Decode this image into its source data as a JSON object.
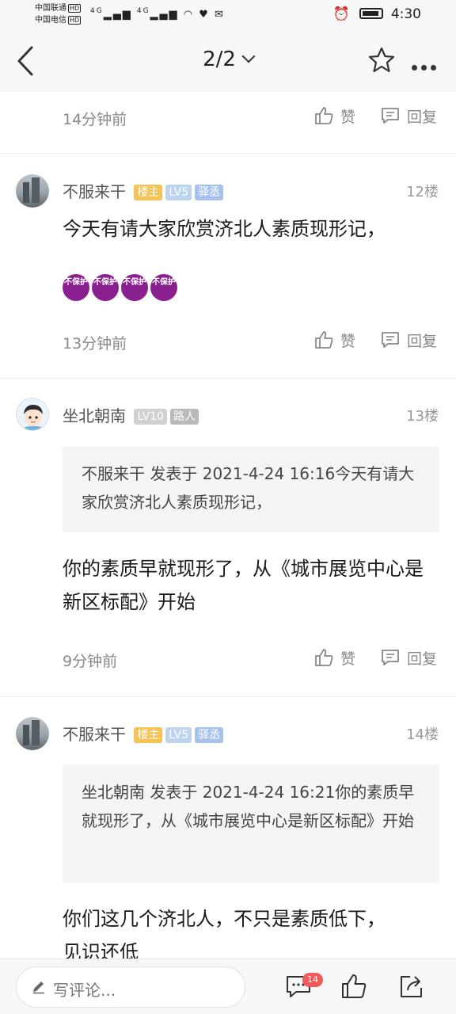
{
  "status_bar": {
    "carrier_1": "中国联通",
    "carrier_2": "中国电信",
    "hd_label": "HD",
    "network": "4G",
    "time": "4:30"
  },
  "nav": {
    "page_indicator": "2/2"
  },
  "top_meta": {
    "time": "14分钟前",
    "like_label": "赞",
    "reply_label": "回复"
  },
  "posts": [
    {
      "username": "不服来干",
      "badges": [
        "楼主",
        "LV5",
        "驿丞"
      ],
      "floor": "12楼",
      "text": "今天有请大家欣赏济北人素质现形记，",
      "emojis": [
        "不保护",
        "不保护",
        "不保护",
        "不保护"
      ],
      "time": "13分钟前",
      "like_label": "赞",
      "reply_label": "回复"
    },
    {
      "username": "坐北朝南",
      "badges": [
        "LV10",
        "路人"
      ],
      "floor": "13楼",
      "quote": "不服来干 发表于 2021-4-24 16:16今天有请大家欣赏济北人素质现形记，",
      "text": "你的素质早就现形了，从《城市展览中心是新区标配》开始",
      "time": "9分钟前",
      "like_label": "赞",
      "reply_label": "回复"
    },
    {
      "username": "不服来干",
      "badges": [
        "楼主",
        "LV5",
        "驿丞"
      ],
      "floor": "14楼",
      "quote": "坐北朝南 发表于 2021-4-24 16:21你的素质早就现形了，从《城市展览中心是新区标配》开始",
      "text": "你们这几个济北人，不只是素质低下，见识还低"
    }
  ],
  "bottom_bar": {
    "comment_placeholder": "写评论...",
    "comment_count": "14"
  },
  "colors": {
    "badge_owner": "#f5c355",
    "badge_level": "#bcd4f0",
    "badge_title": "#a6c2ec",
    "count_badge": "#f05a5a",
    "emoji_bg": "#8a1f8f"
  }
}
